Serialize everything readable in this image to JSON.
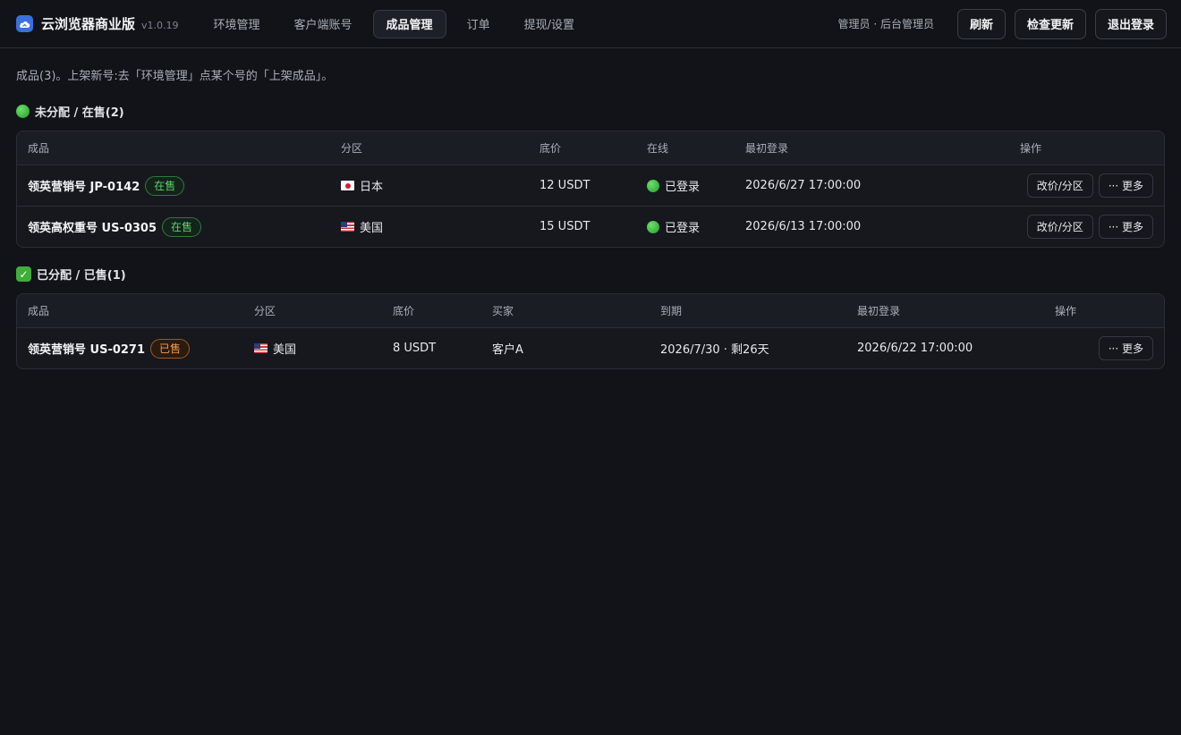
{
  "header": {
    "app_title": "云浏览器商业版",
    "version": "v1.0.19",
    "tabs": [
      {
        "label": "环境管理",
        "active": false
      },
      {
        "label": "客户端账号",
        "active": false
      },
      {
        "label": "成品管理",
        "active": true
      },
      {
        "label": "订单",
        "active": false
      },
      {
        "label": "提现/设置",
        "active": false
      }
    ],
    "user_info": "管理员 · 后台管理员",
    "buttons": {
      "refresh": "刷新",
      "check_update": "检查更新",
      "logout": "退出登录"
    }
  },
  "main": {
    "hint": "成品(3)。上架新号:去「环境管理」点某个号的「上架成品」。",
    "unassigned": {
      "title": "未分配 / 在售(2)",
      "columns": [
        "成品",
        "分区",
        "底价",
        "在线",
        "最初登录",
        "操作"
      ],
      "rows": [
        {
          "name": "领英营销号 JP-0142",
          "badge": "在售",
          "flag": "jp",
          "region": "日本",
          "price": "12 USDT",
          "online": "已登录",
          "first_login": "2026/6/27 17:00:00",
          "btn_edit": "改价/分区",
          "btn_more": "··· 更多"
        },
        {
          "name": "领英高权重号 US-0305",
          "badge": "在售",
          "flag": "us",
          "region": "美国",
          "price": "15 USDT",
          "online": "已登录",
          "first_login": "2026/6/13 17:00:00",
          "btn_edit": "改价/分区",
          "btn_more": "··· 更多"
        }
      ]
    },
    "assigned": {
      "title": "已分配 / 已售(1)",
      "columns": [
        "成品",
        "分区",
        "底价",
        "买家",
        "到期",
        "最初登录",
        "操作"
      ],
      "rows": [
        {
          "name": "领英营销号 US-0271",
          "badge": "已售",
          "flag": "us",
          "region": "美国",
          "price": "8 USDT",
          "buyer": "客户A",
          "expiry": "2026/7/30 · 剩26天",
          "first_login": "2026/6/22 17:00:00",
          "btn_more": "··· 更多"
        }
      ]
    }
  },
  "colors": {
    "accent": "#3b6fe0",
    "online_green": "#4cc255",
    "sold_orange": "#f29b4a",
    "background": "#111318"
  }
}
